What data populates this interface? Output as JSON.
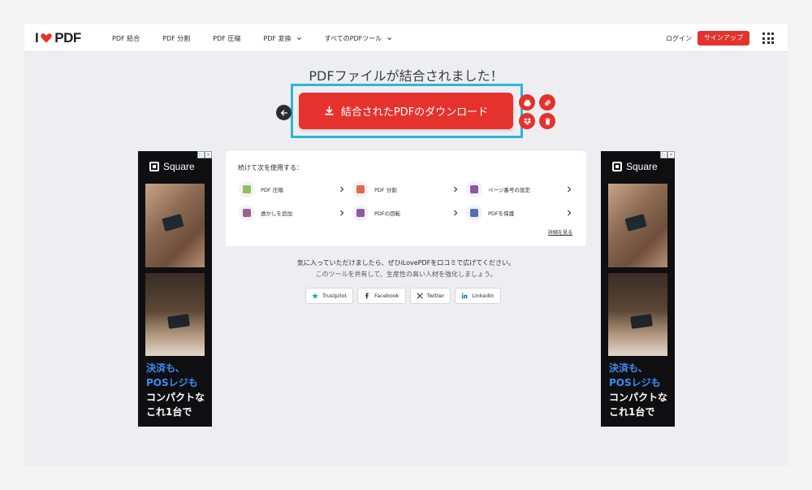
{
  "header": {
    "logo": {
      "left": "I",
      "right": "PDF"
    },
    "nav": [
      {
        "label": "PDF 結合",
        "has_dropdown": false
      },
      {
        "label": "PDF 分割",
        "has_dropdown": false
      },
      {
        "label": "PDF 圧縮",
        "has_dropdown": false
      },
      {
        "label": "PDF 変換",
        "has_dropdown": true
      },
      {
        "label": "すべてのPDFツール",
        "has_dropdown": true
      }
    ],
    "login": "ログイン",
    "signup": "サインアップ",
    "apps_icon": "apps-grid-icon"
  },
  "result": {
    "title": "PDFファイルが結合されました！",
    "download_label": "結合されたPDFのダウンロード",
    "download_icon": "download-icon",
    "back_icon": "arrow-left-icon",
    "side_actions": [
      {
        "name": "google-drive",
        "icon": "drive-icon"
      },
      {
        "name": "copy-link",
        "icon": "link-icon"
      },
      {
        "name": "dropbox",
        "icon": "dropbox-icon"
      },
      {
        "name": "delete",
        "icon": "trash-icon"
      }
    ],
    "accent": "#e5322d",
    "highlight_color": "#2bb5d8"
  },
  "continue": {
    "title": "続けて次を使用する：",
    "tools": [
      {
        "label": "PDF 圧縮",
        "color": "#8fbf5a"
      },
      {
        "label": "PDF 分割",
        "color": "#e26a4a"
      },
      {
        "label": "ページ番号の設定",
        "color": "#8a5a9e"
      },
      {
        "label": "透かしを追加",
        "color": "#9b5f95"
      },
      {
        "label": "PDFの回転",
        "color": "#8e5aa8"
      },
      {
        "label": "PDFを保護",
        "color": "#4e6fb0"
      }
    ],
    "more": "詳細を見る"
  },
  "share": {
    "line1": "気に入っていただけましたら、ぜひiLovePDFを口コミで広げてください。",
    "line2": "このツールを共有して、生産性の高い人材を強化しましょう。",
    "buttons": [
      {
        "label": "Trustpilot",
        "icon": "star-icon",
        "color": "#00b67a"
      },
      {
        "label": "Facebook",
        "icon": "facebook-icon",
        "color": "#2b2b33"
      },
      {
        "label": "Twitter",
        "icon": "x-icon",
        "color": "#2b2b33"
      },
      {
        "label": "LinkedIn",
        "icon": "linkedin-icon",
        "color": "#0a66c2"
      }
    ]
  },
  "ads": {
    "brand": "Square",
    "close_marks": [
      "▷",
      "×"
    ],
    "lines_blue": [
      "決済も、",
      "POSレジも"
    ],
    "lines_white": [
      "コンパクトな",
      "これ1台で"
    ]
  }
}
